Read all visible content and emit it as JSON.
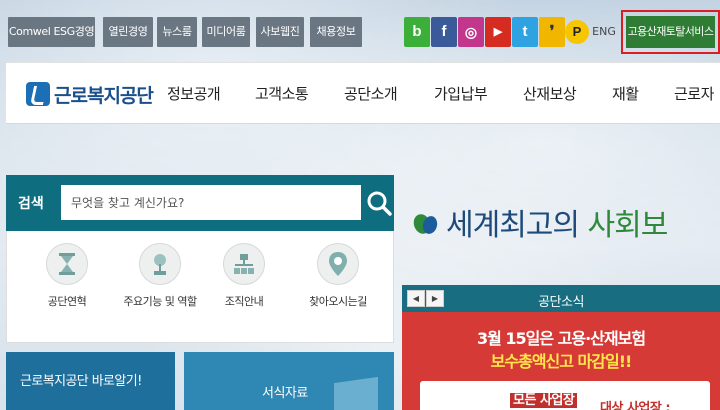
{
  "util_buttons": [
    "Comwel ESG경영",
    "열린경영",
    "뉴스룸",
    "미디어룸",
    "사보웹진",
    "채용정보"
  ],
  "sns": [
    {
      "icon": "blog-icon",
      "glyph": "b",
      "color": "#3cae3a"
    },
    {
      "icon": "facebook-icon",
      "glyph": "f",
      "color": "#3b5a9a"
    },
    {
      "icon": "instagram-icon",
      "glyph": "◎",
      "color": "#c2378b"
    },
    {
      "icon": "youtube-icon",
      "glyph": "▶",
      "color": "#d62b20"
    },
    {
      "icon": "twitter-icon",
      "glyph": "t",
      "color": "#2fa3e1"
    },
    {
      "icon": "kakaostory-icon",
      "glyph": "❜",
      "color": "#f0b600"
    },
    {
      "icon": "kakao-pay-icon",
      "glyph": "P",
      "color": "#222"
    }
  ],
  "eng": "ENG",
  "portal": "고용산재토탈서비스",
  "logo": "근로복지공단",
  "menu": [
    "정보공개",
    "고객소통",
    "공단소개",
    "가입납부",
    "산재보상",
    "재활",
    "근로자"
  ],
  "search": {
    "label": "검색",
    "placeholder": "무엇을 찾고 계신가요?"
  },
  "quick_links": [
    {
      "label": "공단연혁",
      "icon": "hourglass-icon"
    },
    {
      "label": "주요기능 및 역할",
      "icon": "plant-icon"
    },
    {
      "label": "조직안내",
      "icon": "org-chart-icon"
    },
    {
      "label": "찾아오시는길",
      "icon": "location-pin-icon"
    }
  ],
  "banners": {
    "about": "근로복지공단 바로알기!",
    "forms": "서식자료"
  },
  "hero": {
    "part1": "세계최고의 ",
    "part2": "사회보"
  },
  "news": {
    "title": "공단소식",
    "prev": "◀",
    "next": "▶",
    "line1": "3월 15일은 고용·산재보험",
    "line2": "보수총액신고 마감일!!",
    "line3_label": "대상 사업장 : ",
    "line3_value": "모든 사업장"
  }
}
